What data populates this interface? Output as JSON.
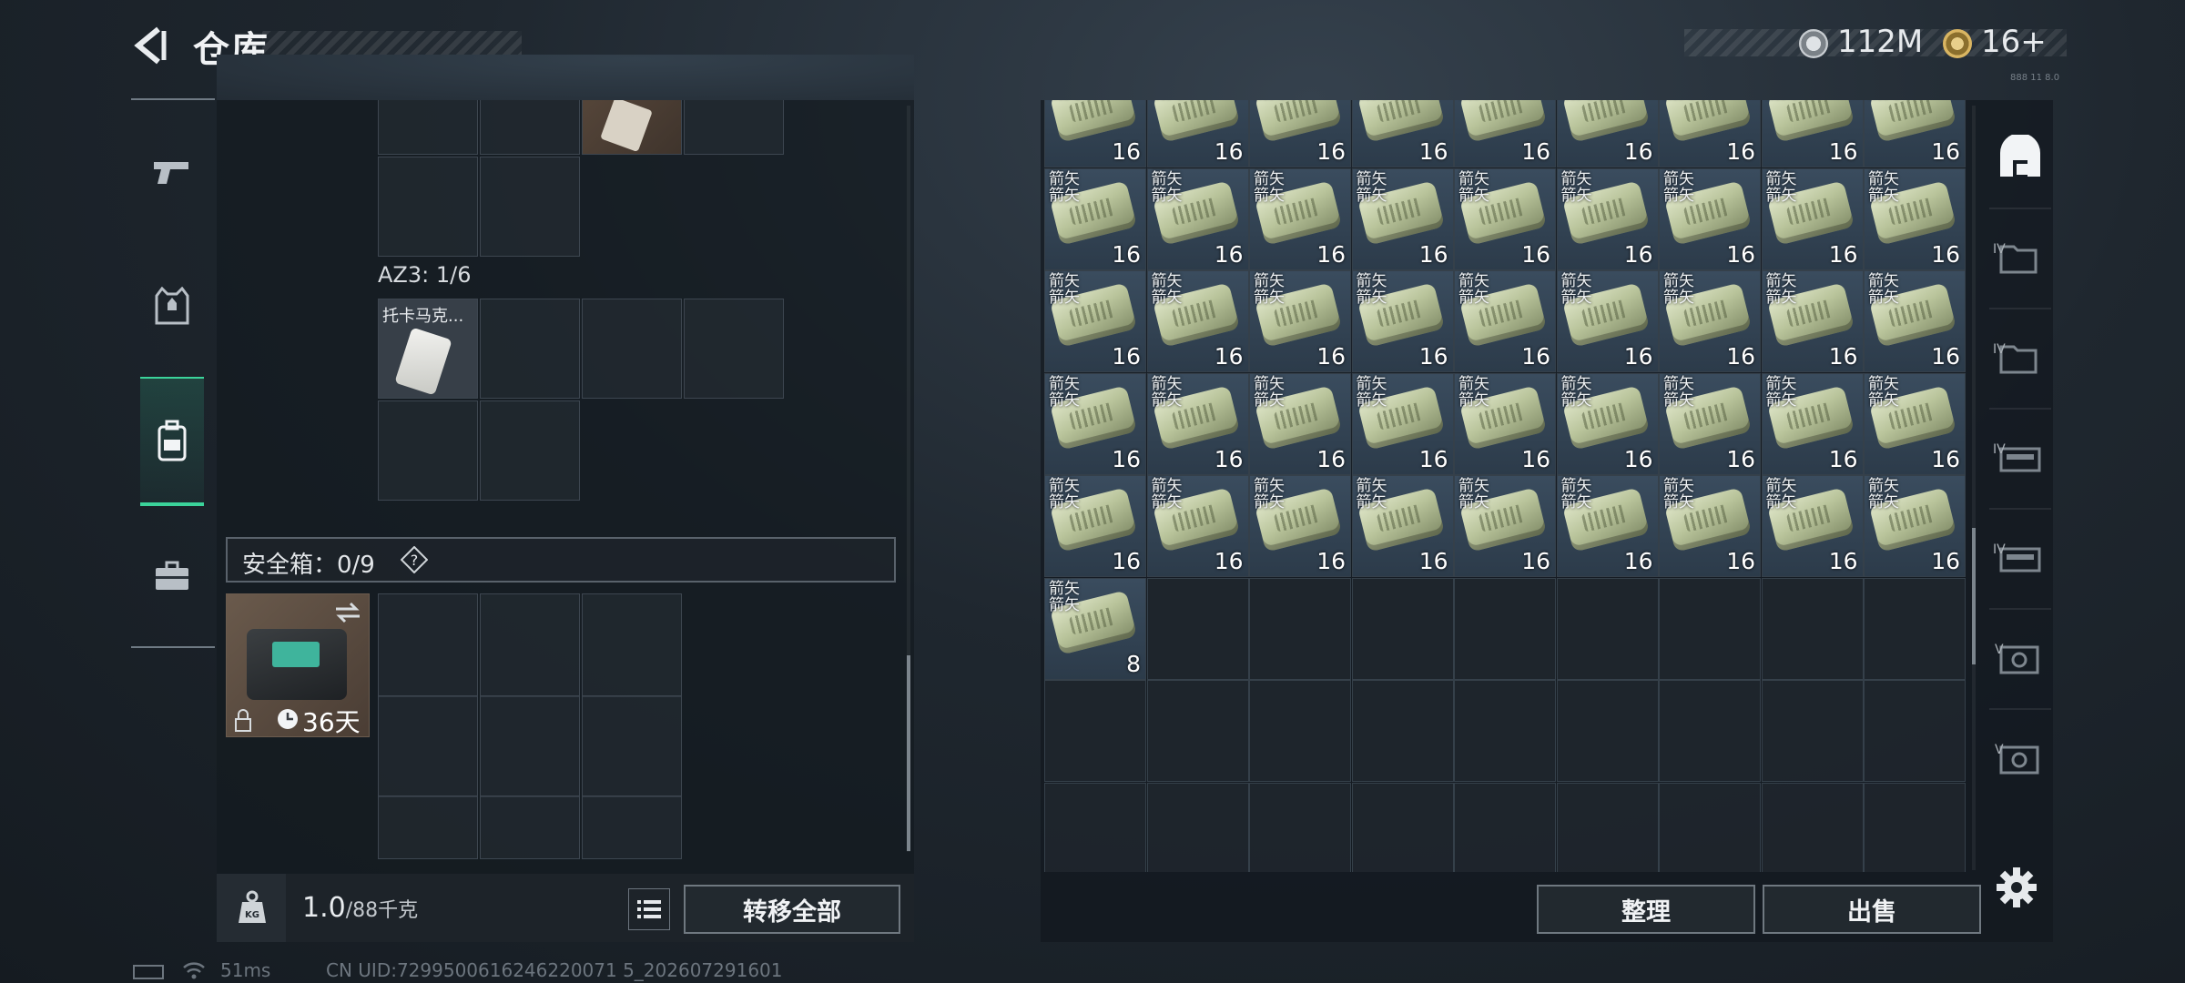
{
  "header": {
    "title": "仓库",
    "silver_value": "112M",
    "gold_value": "16+",
    "mini_code": "888 11 8.0"
  },
  "nav": {
    "items": [
      "gun",
      "armor",
      "backpack",
      "briefcase"
    ],
    "active": "backpack"
  },
  "left": {
    "top_item_icon": "tool-icon",
    "az3_label": "AZ3: 1/6",
    "az3_item_name": "托卡马克...",
    "safe_label": "安全箱：0/9",
    "safe_help": "?",
    "case_days": "36天"
  },
  "bottom_left": {
    "weight": "1.0",
    "weight_max": "/88千克",
    "transfer_all": "转移全部"
  },
  "grid": {
    "item_name": "箭矢",
    "full_count": "16",
    "last_count": "8",
    "columns": 9,
    "filled_rows": 5,
    "total_rows": 8,
    "extra_items": 1
  },
  "right_sidebar": {
    "tags": [
      "",
      "IV",
      "IV",
      "IV",
      "IV",
      "V",
      "V"
    ]
  },
  "bottom_right": {
    "sort": "整理",
    "sell": "出售"
  },
  "status": {
    "ping": "51ms",
    "uid": "CN UID:7299500616246220071 5_202607291601"
  }
}
